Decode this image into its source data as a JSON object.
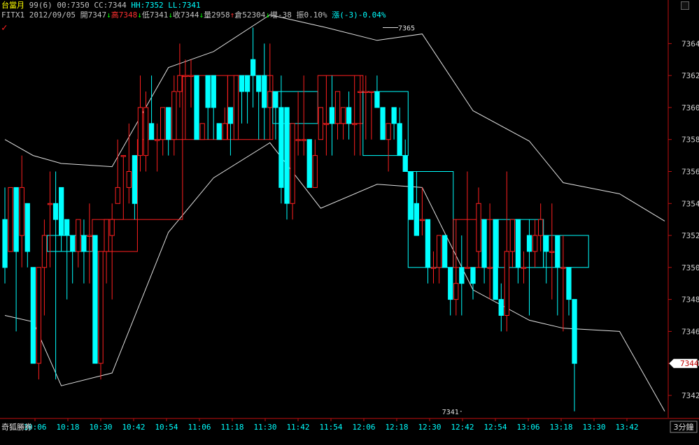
{
  "header": {
    "line1": [
      {
        "text": "台當月",
        "color": "#ffff00"
      },
      {
        "text": " 99(6) ",
        "color": "#c0c0c0"
      },
      {
        "text": "00:7350",
        "color": "#c0c0c0"
      },
      {
        "text": " CC:7344",
        "color": "#c0c0c0"
      },
      {
        "text": " HH:7352",
        "color": "#00ffff"
      },
      {
        "text": " LL:7341",
        "color": "#00ffff"
      }
    ],
    "line2": [
      {
        "text": "FITX1 2012/09/05 ",
        "color": "#c0c0c0"
      },
      {
        "text": "開7347",
        "color": "#c0c0c0"
      },
      {
        "text": "↓",
        "color": "#00ff00"
      },
      {
        "text": "高7348",
        "color": "#ff3030"
      },
      {
        "text": "↓",
        "color": "#00ff00"
      },
      {
        "text": "低7341",
        "color": "#c0c0c0"
      },
      {
        "text": "↓",
        "color": "#00ff00"
      },
      {
        "text": "收7344",
        "color": "#c0c0c0"
      },
      {
        "text": "↓",
        "color": "#00ff00"
      },
      {
        "text": "量2958",
        "color": "#c0c0c0"
      },
      {
        "text": "↑",
        "color": "#ff3030"
      },
      {
        "text": "倉52304",
        "color": "#c0c0c0"
      },
      {
        "text": "↓",
        "color": "#00ff00"
      },
      {
        "text": "增-38",
        "color": "#c0c0c0"
      },
      {
        "text": " 振0.10%",
        "color": "#c0c0c0"
      },
      {
        "text": " 漲(-3)-0.04%",
        "color": "#00ffff"
      }
    ]
  },
  "footer": {
    "brand": "奇狐勝券",
    "period": "3分鐘"
  },
  "chart_data": {
    "type": "candlestick",
    "ylim": [
      7340.6,
      7366.2
    ],
    "y_ticks": [
      7342,
      7344,
      7346,
      7348,
      7350,
      7352,
      7354,
      7356,
      7358,
      7360,
      7362,
      7364
    ],
    "x_labels": [
      "10:06",
      "10:18",
      "10:30",
      "10:42",
      "10:54",
      "11:06",
      "11:18",
      "11:30",
      "11:42",
      "11:54",
      "12:06",
      "12:18",
      "12:30",
      "12:42",
      "12:54",
      "13:06",
      "13:18",
      "13:30",
      "13:42"
    ],
    "current_price_label": "7344",
    "annotations": [
      {
        "text": "7365",
        "index": 67,
        "price": 7365
      },
      {
        "text": "7341",
        "index": 81,
        "price": 7341
      }
    ],
    "candles": [
      [
        7353,
        7355,
        7349,
        7350
      ],
      [
        7351,
        7355,
        7351,
        7355
      ],
      [
        7355,
        7355,
        7346,
        7351
      ],
      [
        7352,
        7357,
        7350,
        7355
      ],
      [
        7354,
        7354,
        7350,
        7351
      ],
      [
        7350,
        7350,
        7344,
        7344
      ],
      [
        7344,
        7350,
        7343,
        7350
      ],
      [
        7350,
        7353,
        7347,
        7352
      ],
      [
        7354,
        7356,
        7350,
        7354
      ],
      [
        7354,
        7356,
        7343,
        7353
      ],
      [
        7355,
        7355,
        7351,
        7352
      ],
      [
        7353,
        7353,
        7348,
        7352
      ],
      [
        7352,
        7352,
        7349,
        7351
      ],
      [
        7351,
        7353,
        7350,
        7353
      ],
      [
        7352,
        7353,
        7349,
        7351
      ],
      [
        7352,
        7354,
        7349,
        7352
      ],
      [
        7352,
        7352,
        7346,
        7344
      ],
      [
        7344,
        7351,
        7343,
        7351
      ],
      [
        7351,
        7351,
        7349,
        7353
      ],
      [
        7352,
        7354,
        7348,
        7353
      ],
      [
        7354,
        7358,
        7354,
        7355
      ],
      [
        7357,
        7357,
        7353,
        7357
      ],
      [
        7355,
        7359,
        7354,
        7356
      ],
      [
        7357,
        7357,
        7353,
        7354
      ],
      [
        7357,
        7362,
        7356,
        7360
      ],
      [
        7357,
        7361,
        7356,
        7360
      ],
      [
        7359,
        7362,
        7358,
        7358
      ],
      [
        7358,
        7359,
        7356,
        7358
      ],
      [
        7358,
        7360,
        7357,
        7360
      ],
      [
        7360,
        7360,
        7357,
        7358
      ],
      [
        7358,
        7362,
        7357,
        7361
      ],
      [
        7361,
        7364,
        7360,
        7362
      ],
      [
        7362,
        7363,
        7358,
        7362
      ],
      [
        7362,
        7363,
        7360,
        7362
      ],
      [
        7362,
        7362,
        7358,
        7358
      ],
      [
        7358,
        7359,
        7358,
        7359
      ],
      [
        7362,
        7362,
        7358,
        7360
      ],
      [
        7362,
        7362,
        7358,
        7360
      ],
      [
        7359,
        7359,
        7358,
        7358
      ],
      [
        7358,
        7360,
        7358,
        7359
      ],
      [
        7360,
        7360,
        7357,
        7359
      ],
      [
        7358,
        7360,
        7358,
        7362
      ],
      [
        7362,
        7362,
        7359,
        7361
      ],
      [
        7362,
        7362,
        7359,
        7361
      ],
      [
        7363,
        7365,
        7360,
        7362
      ],
      [
        7362,
        7362,
        7358,
        7361
      ],
      [
        7362,
        7364,
        7358,
        7360
      ],
      [
        7360,
        7364,
        7358,
        7361
      ],
      [
        7361,
        7361,
        7358,
        7360
      ],
      [
        7360,
        7362,
        7354,
        7355
      ],
      [
        7360,
        7360,
        7353,
        7354
      ],
      [
        7354,
        7359,
        7353,
        7359
      ],
      [
        7358,
        7361,
        7357,
        7358
      ],
      [
        7358,
        7362,
        7357,
        7358
      ],
      [
        7358,
        7358,
        7355,
        7355
      ],
      [
        7355,
        7358,
        7355,
        7357
      ],
      [
        7358,
        7360,
        7358,
        7360
      ],
      [
        7359,
        7362,
        7357,
        7359
      ],
      [
        7360,
        7362,
        7357,
        7359
      ],
      [
        7359,
        7361,
        7358,
        7361
      ],
      [
        7359,
        7360,
        7358,
        7360
      ],
      [
        7360,
        7361,
        7358,
        7359
      ],
      [
        7359,
        7362,
        7357,
        7359
      ],
      [
        7361,
        7362,
        7357,
        7361
      ],
      [
        7361,
        7362,
        7358,
        7361
      ],
      [
        7361,
        7361,
        7358,
        7361
      ],
      [
        7361,
        7362,
        7360,
        7360
      ],
      [
        7360,
        7360,
        7358,
        7358
      ],
      [
        7358,
        7359,
        7356,
        7359
      ],
      [
        7360,
        7360,
        7358,
        7359
      ],
      [
        7359,
        7360,
        7357,
        7357
      ],
      [
        7357,
        7358,
        7356,
        7356
      ],
      [
        7356,
        7356,
        7353,
        7353
      ],
      [
        7354,
        7356,
        7352,
        7352
      ],
      [
        7353,
        7355,
        7352,
        7353
      ],
      [
        7353,
        7353,
        7349,
        7350
      ],
      [
        7350,
        7351,
        7349,
        7350
      ],
      [
        7350,
        7352,
        7349,
        7352
      ],
      [
        7352,
        7352,
        7350,
        7350
      ],
      [
        7350,
        7350,
        7347,
        7348
      ],
      [
        7348,
        7353,
        7347,
        7349
      ],
      [
        7350,
        7352,
        7347,
        7349
      ],
      [
        7350,
        7356,
        7350,
        7350
      ],
      [
        7350,
        7350,
        7348,
        7349
      ],
      [
        7351,
        7355,
        7350,
        7354
      ],
      [
        7353,
        7353,
        7349,
        7350
      ],
      [
        7350,
        7354,
        7348,
        7350
      ],
      [
        7353,
        7353,
        7349,
        7348
      ],
      [
        7348,
        7349,
        7346,
        7347
      ],
      [
        7347,
        7356,
        7346,
        7351
      ],
      [
        7351,
        7353,
        7350,
        7353
      ],
      [
        7353,
        7353,
        7349,
        7350
      ],
      [
        7350,
        7351,
        7349,
        7350
      ],
      [
        7352,
        7353,
        7347,
        7351
      ],
      [
        7351,
        7353,
        7350,
        7352
      ],
      [
        7352,
        7354,
        7351,
        7353
      ],
      [
        7352,
        7352,
        7349,
        7351
      ],
      [
        7351,
        7354,
        7348,
        7351
      ],
      [
        7352,
        7352,
        7347,
        7350
      ],
      [
        7350,
        7352,
        7346,
        7350
      ],
      [
        7350,
        7350,
        7347,
        7348
      ],
      [
        7348,
        7348,
        7341,
        7344
      ]
    ],
    "boxes": [
      {
        "from": 8,
        "to": 15,
        "high": 7352,
        "low": 7351,
        "up": false
      },
      {
        "from": 16,
        "to": 23,
        "high": 7353,
        "low": 7351,
        "up": true
      },
      {
        "from": 24,
        "to": 31,
        "high": 7358,
        "low": 7353,
        "up": true
      },
      {
        "from": 32,
        "to": 39,
        "high": 7362,
        "low": 7358,
        "up": true
      },
      {
        "from": 40,
        "to": 47,
        "high": 7362,
        "low": 7358,
        "up": true
      },
      {
        "from": 48,
        "to": 55,
        "high": 7361,
        "low": 7359,
        "up": false
      },
      {
        "from": 56,
        "to": 63,
        "high": 7362,
        "low": 7359,
        "up": true
      },
      {
        "from": 64,
        "to": 71,
        "high": 7361,
        "low": 7357,
        "up": false
      },
      {
        "from": 72,
        "to": 79,
        "high": 7356,
        "low": 7350,
        "up": false
      },
      {
        "from": 80,
        "to": 87,
        "high": 7353,
        "low": 7350,
        "up": true
      },
      {
        "from": 88,
        "to": 95,
        "high": 7353,
        "low": 7350,
        "up": false
      },
      {
        "from": 96,
        "to": 103,
        "high": 7352,
        "low": 7350,
        "up": false
      }
    ],
    "upper_band": [
      {
        "i": 0,
        "v": 7358
      },
      {
        "i": 5,
        "v": 7357
      },
      {
        "i": 10,
        "v": 7356.5
      },
      {
        "i": 19,
        "v": 7356.3
      },
      {
        "i": 29,
        "v": 7362.5
      },
      {
        "i": 37,
        "v": 7363.5
      },
      {
        "i": 47,
        "v": 7365.8
      },
      {
        "i": 57,
        "v": 7365
      },
      {
        "i": 66,
        "v": 7364.2
      },
      {
        "i": 74,
        "v": 7364.6
      },
      {
        "i": 83,
        "v": 7359.8
      },
      {
        "i": 93,
        "v": 7357.9
      },
      {
        "i": 99,
        "v": 7355.3
      },
      {
        "i": 109,
        "v": 7354.6
      },
      {
        "i": 117,
        "v": 7352.9
      }
    ],
    "lower_band": [
      {
        "i": 0,
        "v": 7347
      },
      {
        "i": 5,
        "v": 7346.6
      },
      {
        "i": 10,
        "v": 7342.6
      },
      {
        "i": 19,
        "v": 7343.4
      },
      {
        "i": 29,
        "v": 7352.2
      },
      {
        "i": 37,
        "v": 7355.6
      },
      {
        "i": 47,
        "v": 7357.8
      },
      {
        "i": 56,
        "v": 7353.7
      },
      {
        "i": 66,
        "v": 7355.2
      },
      {
        "i": 74,
        "v": 7355
      },
      {
        "i": 83,
        "v": 7348.6
      },
      {
        "i": 93,
        "v": 7346.7
      },
      {
        "i": 99,
        "v": 7346.2
      },
      {
        "i": 109,
        "v": 7346
      },
      {
        "i": 117,
        "v": 7341
      }
    ],
    "colors": {
      "up": "#ff2020",
      "down": "#00ffff",
      "band": "#e0e0e0",
      "axis": "#d0d0d0",
      "frame": "#c01010",
      "label_text": "#00ffff"
    }
  }
}
